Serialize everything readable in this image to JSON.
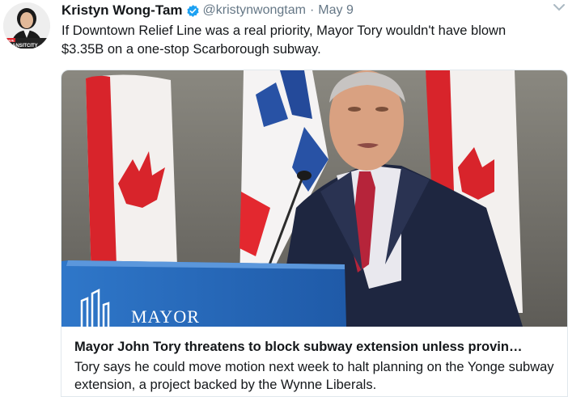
{
  "tweet": {
    "author_name": "Kristyn Wong-Tam",
    "handle": "@kristynwongtam",
    "separator": "·",
    "timestamp": "May 9",
    "text": "If Downtown Relief Line was a real priority, Mayor Tory wouldn't have blown $3.35B on a one-stop Scarborough subway.",
    "verified": true,
    "avatar_badge": "SAVE TRANSITCITY"
  },
  "card": {
    "title": "Mayor John Tory threatens to block subway extension unless provin…",
    "description": "Tory says he could move motion next week to halt planning on the Yonge subway extension, a project backed by the Wynne Liberals.",
    "image_podium_text": "MAYOR"
  },
  "icons": {
    "verified": "verified-badge-icon",
    "menu": "chevron-down-icon"
  },
  "colors": {
    "verified": "#1da1f2",
    "muted_text": "#657786",
    "text": "#14171a",
    "card_border": "#e1e8ed"
  }
}
